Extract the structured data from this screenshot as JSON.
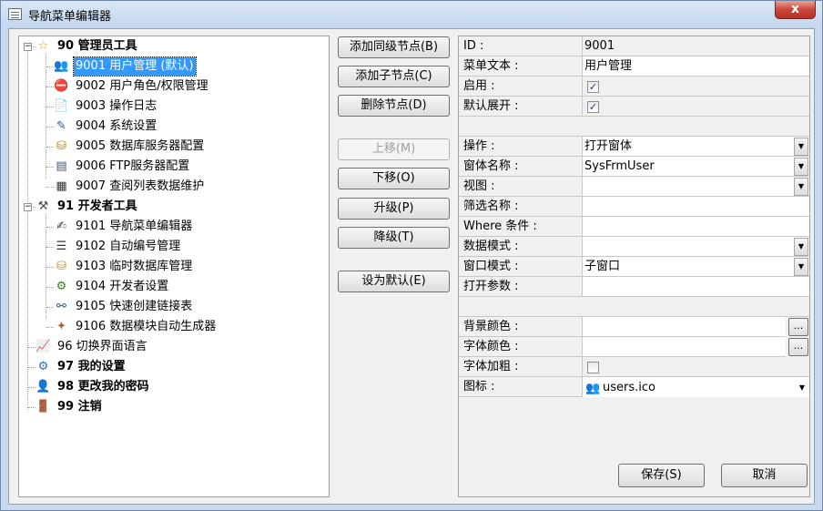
{
  "window": {
    "title": "导航菜单编辑器",
    "close_glyph": "x"
  },
  "tree": {
    "nodes": [
      {
        "label": "90 管理员工具",
        "icon": "star-icon",
        "glyph": "☆",
        "color": "#d9a400",
        "bold": true,
        "level": 0,
        "expander": "−"
      },
      {
        "label": "9001 用户管理 (默认)",
        "icon": "users-icon",
        "glyph": "👥",
        "color": "#b05010",
        "level": 1,
        "selected": true
      },
      {
        "label": "9002 用户角色/权限管理",
        "icon": "stop-icon",
        "glyph": "⛔",
        "color": "#d00000",
        "level": 1
      },
      {
        "label": "9003 操作日志",
        "icon": "log-document-icon",
        "glyph": "📄",
        "color": "#555555",
        "level": 1
      },
      {
        "label": "9004 系统设置",
        "icon": "settings-icon",
        "glyph": "✎",
        "color": "#2060a0",
        "level": 1
      },
      {
        "label": "9005 数据库服务器配置",
        "icon": "database-server-icon",
        "glyph": "⛁",
        "color": "#c08000",
        "level": 1
      },
      {
        "label": "9006 FTP服务器配置",
        "icon": "ftp-server-icon",
        "glyph": "▤",
        "color": "#3050a0",
        "level": 1
      },
      {
        "label": "9007 查阅列表数据维护",
        "icon": "list-data-icon",
        "glyph": "▦",
        "color": "#333333",
        "level": 1
      },
      {
        "label": "91 开发者工具",
        "icon": "developer-tools-icon",
        "glyph": "⚒",
        "color": "#505050",
        "bold": true,
        "level": 0,
        "expander": "−"
      },
      {
        "label": "9101 导航菜单编辑器",
        "icon": "menu-editor-icon",
        "glyph": "✍",
        "color": "#404040",
        "level": 1
      },
      {
        "label": "9102 自动编号管理",
        "icon": "numbering-icon",
        "glyph": "☰",
        "color": "#203060",
        "level": 1
      },
      {
        "label": "9103 临时数据库管理",
        "icon": "temp-database-icon",
        "glyph": "⛁",
        "color": "#c09020",
        "level": 1
      },
      {
        "label": "9104 开发者设置",
        "icon": "developer-settings-icon",
        "glyph": "⚙",
        "color": "#408020",
        "level": 1
      },
      {
        "label": "9105 快速创建链接表",
        "icon": "link-table-icon",
        "glyph": "⚯",
        "color": "#305080",
        "level": 1
      },
      {
        "label": "9106 数据模块自动生成器",
        "icon": "magic-wand-icon",
        "glyph": "✦",
        "color": "#c06020",
        "level": 1
      },
      {
        "label": "96 切换界面语言",
        "icon": "language-chart-icon",
        "glyph": "📈",
        "color": "#206040",
        "level": 0
      },
      {
        "label": "97 我的设置",
        "icon": "my-settings-icon",
        "glyph": "⚙",
        "color": "#3070b0",
        "bold": true,
        "level": 0
      },
      {
        "label": "98 更改我的密码",
        "icon": "user-password-icon",
        "glyph": "👤",
        "color": "#3060a0",
        "bold": true,
        "level": 0
      },
      {
        "label": "99 注销",
        "icon": "logout-icon",
        "glyph": "🚪",
        "color": "#204080",
        "bold": true,
        "level": 0
      }
    ]
  },
  "actions": {
    "add_sibling": "添加同级节点(B)",
    "add_child": "添加子节点(C)",
    "delete_node": "删除节点(D)",
    "move_up": "上移(M)",
    "move_down": "下移(O)",
    "promote": "升级(P)",
    "demote": "降级(T)",
    "set_default": "设为默认(E)"
  },
  "properties": {
    "id_label": "ID :",
    "id_value": "9001",
    "menu_text_label": "菜单文本 :",
    "menu_text_value": "用户管理",
    "enabled_label": "启用 :",
    "enabled_checked": true,
    "default_expand_label": "默认展开 :",
    "default_expand_checked": true,
    "operation_label": "操作 :",
    "operation_value": "打开窗体",
    "form_name_label": "窗体名称 :",
    "form_name_value": "SysFrmUser",
    "view_label": "视图 :",
    "view_value": "",
    "filter_name_label": "筛选名称 :",
    "filter_name_value": "",
    "where_label": "Where 条件 :",
    "where_value": "",
    "data_mode_label": "数据模式 :",
    "data_mode_value": "",
    "window_mode_label": "窗口模式 :",
    "window_mode_value": "子窗口",
    "open_args_label": "打开参数 :",
    "open_args_value": "",
    "back_color_label": "背景颜色 :",
    "back_color_value": "",
    "fore_color_label": "字体颜色 :",
    "fore_color_value": "",
    "bold_label": "字体加粗 :",
    "bold_checked": false,
    "icon_label": "图标 :",
    "icon_value": "users.ico",
    "ellipsis": "...",
    "check_glyph": "✓",
    "dropdown_glyph": "▼"
  },
  "footer": {
    "save": "保存(S)",
    "cancel": "取消"
  }
}
